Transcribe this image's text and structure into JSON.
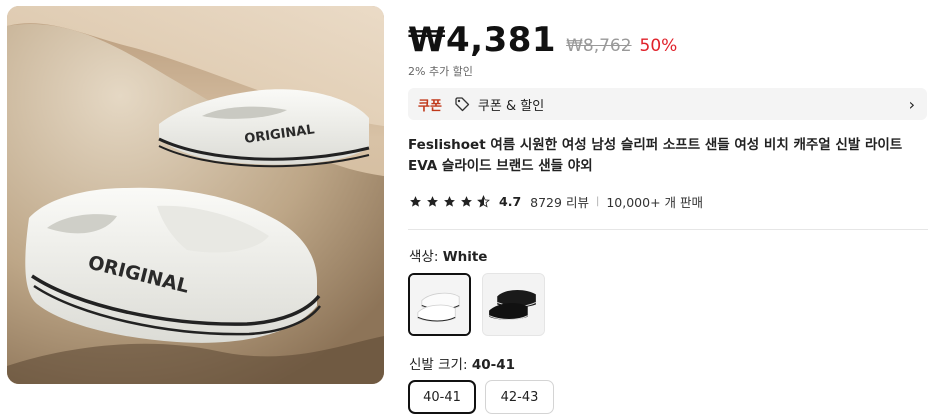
{
  "image": {
    "alt": "ORIGINAL",
    "brand_print": "ORIGINAL"
  },
  "price": {
    "current": "₩4,381",
    "original": "₩8,762",
    "discount": "50%",
    "extra": "2% 추가 할인"
  },
  "coupon": {
    "tag": "쿠폰",
    "label": "쿠폰 & 할인",
    "icon": "tag-icon"
  },
  "product": {
    "title": "Feslishoet 여름 시원한 여성 남성 슬리퍼 소프트 샌들 여성 비치 캐주얼 신발 라이트 EVA 슬라이드 브랜드 샌들 야외"
  },
  "rating": {
    "score": "4.7",
    "stars": 4.5,
    "reviews": "8729 리뷰",
    "sold": "10,000+ 개 판매"
  },
  "color": {
    "label": "색상: ",
    "selected": "White",
    "options": [
      "White",
      "Black"
    ]
  },
  "size": {
    "label": "신발 크기: ",
    "selected": "40-41",
    "options": [
      "40-41",
      "42-43"
    ]
  },
  "colors": {
    "accent_red": "#e0222b",
    "coupon_red": "#c0391b",
    "star": "#222222"
  }
}
